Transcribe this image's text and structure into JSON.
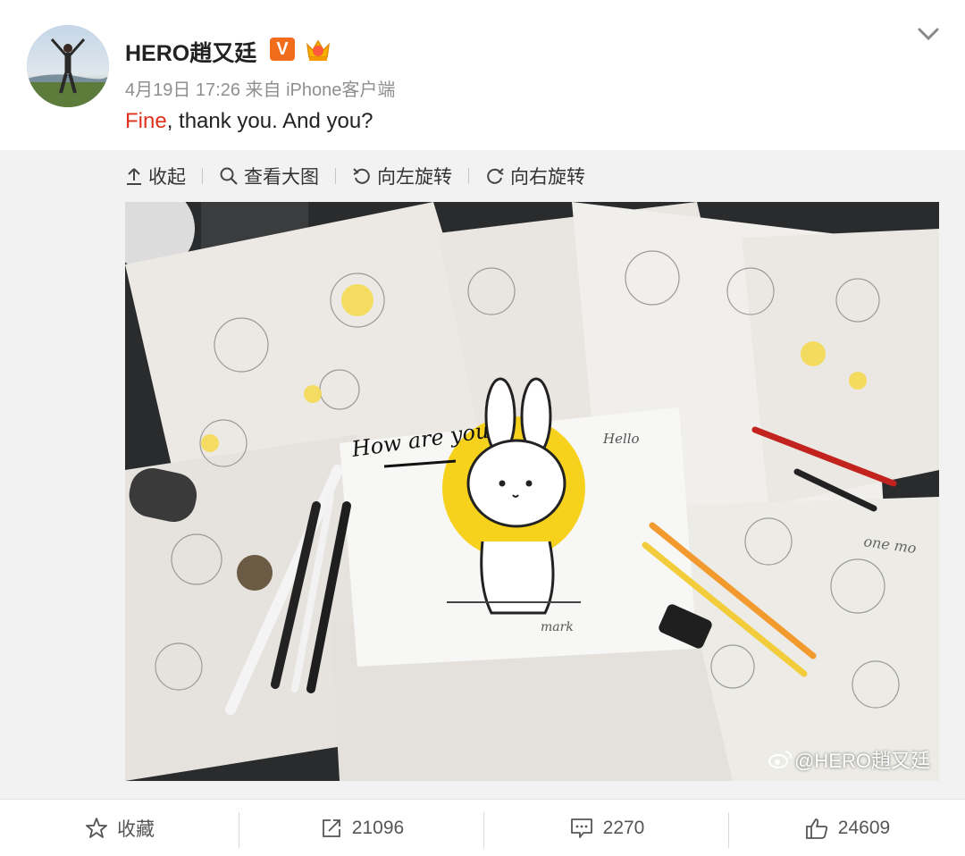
{
  "post": {
    "username": "HERO趙又廷",
    "verified_badge": "V",
    "meta": "4月19日 17:26 来自 iPhone客户端",
    "text_highlight": "Fine",
    "text_rest": ", thank you. And you?",
    "expand_icon": "chevron-down-icon"
  },
  "toolbar": {
    "collapse_label": "收起",
    "view_large_label": "查看大图",
    "rotate_left_label": "向左旋转",
    "rotate_right_label": "向右旋转"
  },
  "image": {
    "watermark": "@HERO趙又廷",
    "handwriting_1": "How are you",
    "handwriting_2": "Hello",
    "handwriting_3": "one mo",
    "handwriting_4": "mark"
  },
  "actions": {
    "favorite_label": "收藏",
    "repost_count": "21096",
    "comment_count": "2270",
    "like_count": "24609"
  },
  "colors": {
    "highlight": "#e0301e",
    "vbadge": "#f26d1b",
    "meta": "#8f8f8f",
    "card_bg": "#f2f2f2"
  }
}
